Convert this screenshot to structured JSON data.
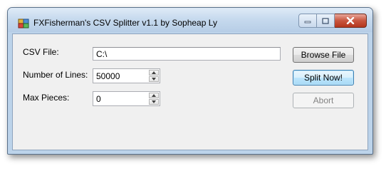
{
  "window": {
    "title": "FXFisherman's CSV Splitter v1.1 by Sopheap Ly",
    "icons": {
      "app": "csv-grid-icon",
      "minimize": "minimize-icon",
      "maximize": "maximize-icon",
      "close": "close-icon"
    }
  },
  "form": {
    "csv_file": {
      "label": "CSV File:",
      "value": "C:\\"
    },
    "number_of_lines": {
      "label": "Number of Lines:",
      "value": "50000"
    },
    "max_pieces": {
      "label": "Max Pieces:",
      "value": "0"
    }
  },
  "buttons": {
    "browse": "Browse File",
    "split": "Split Now!",
    "abort": "Abort"
  }
}
